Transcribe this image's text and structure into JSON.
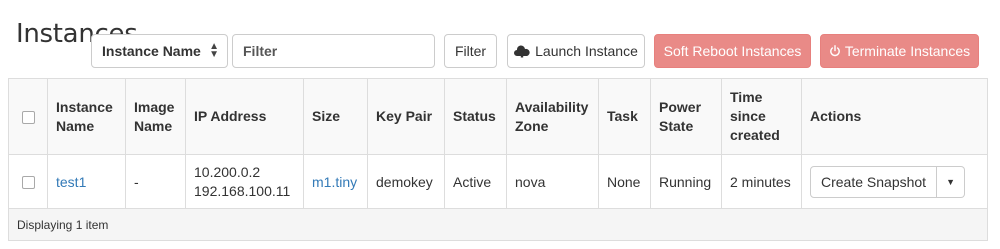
{
  "page": {
    "title": "Instances"
  },
  "toolbar": {
    "filter_field_select": "Instance Name",
    "filter_placeholder": "Filter",
    "filter_button": "Filter",
    "launch_button": "Launch Instance",
    "soft_reboot_button": "Soft Reboot Instances",
    "terminate_button": "Terminate Instances"
  },
  "table": {
    "columns": [
      "Instance Name",
      "Image Name",
      "IP Address",
      "Size",
      "Key Pair",
      "Status",
      "Availability Zone",
      "Task",
      "Power State",
      "Time since created",
      "Actions"
    ],
    "rows": [
      {
        "instance_name": "test1",
        "image_name": "-",
        "ip_addresses": [
          "10.200.0.2",
          "192.168.100.11"
        ],
        "size": "m1.tiny",
        "key_pair": "demokey",
        "status": "Active",
        "availability_zone": "nova",
        "task": "None",
        "power_state": "Running",
        "time_since_created": "2 minutes",
        "action_label": "Create Snapshot"
      }
    ],
    "footer": "Displaying 1 item"
  },
  "colors": {
    "danger_button": "#e98a87",
    "link": "#337ab7",
    "header_bg": "#f9f9f9",
    "footer_bg": "#f5f5f5"
  },
  "icons": {
    "launch": "cloud-upload-icon",
    "terminate": "power-icon",
    "select_caret": "updown-caret-icon",
    "dropdown": "caret-down-icon"
  }
}
